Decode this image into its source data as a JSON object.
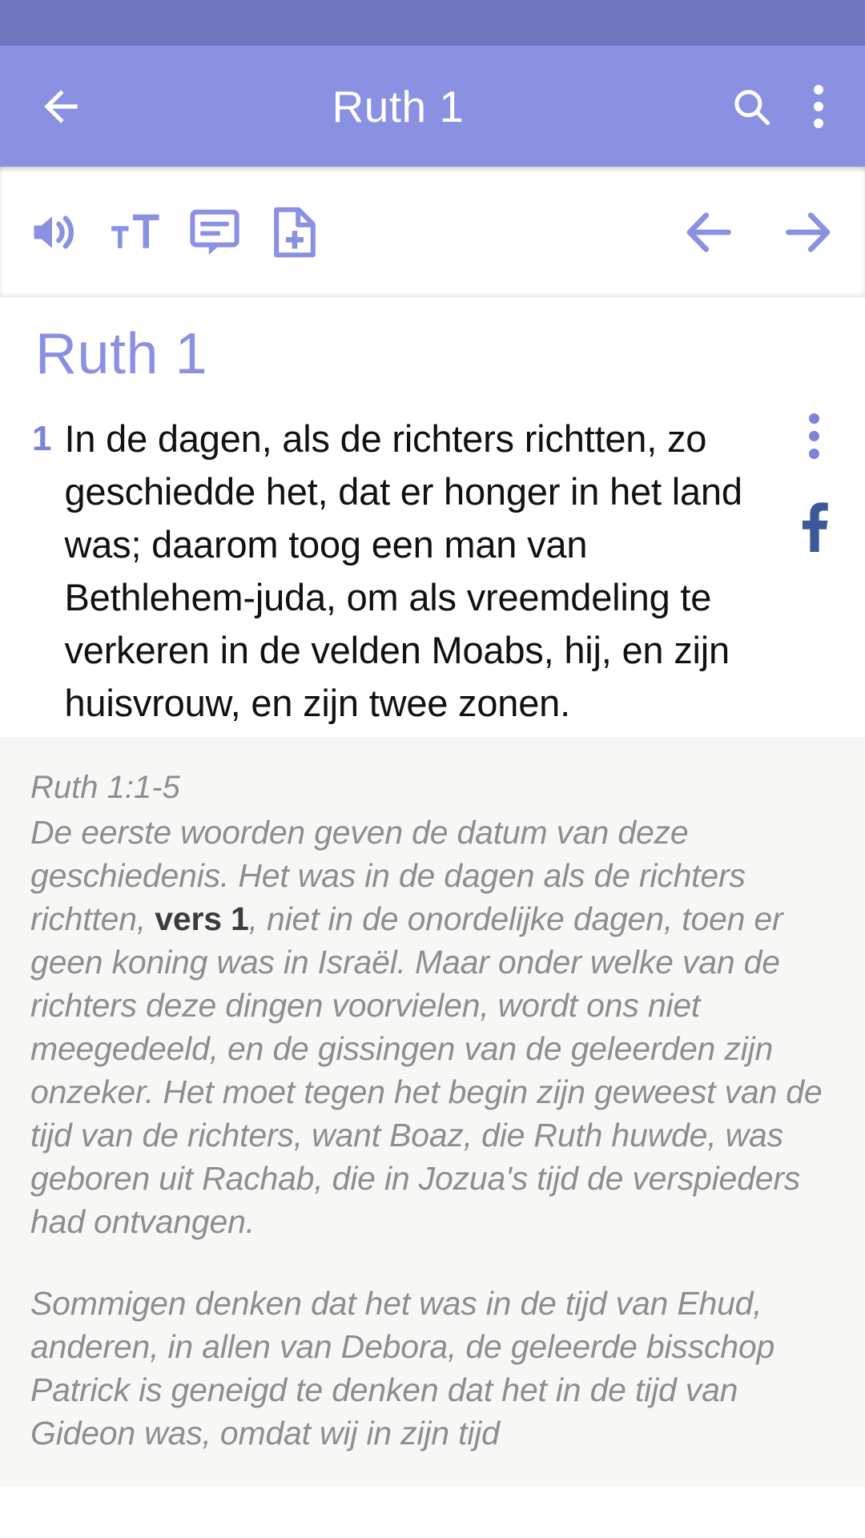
{
  "status_bar": {
    "color": "#6E76BE"
  },
  "app_bar": {
    "color": "#8A90E2",
    "title": "Ruth 1",
    "back_label": "Back",
    "search_label": "Search",
    "overflow_label": "More options"
  },
  "read_toolbar": {
    "audio_label": "Audio",
    "text_size_label": "Text size",
    "notes_label": "Notes",
    "add_note_label": "Add note",
    "prev_label": "Previous chapter",
    "next_label": "Next chapter"
  },
  "chapter": {
    "title": "Ruth 1",
    "accent_color": "#8A90E2"
  },
  "verses": [
    {
      "number": "1",
      "text": "In de dagen, als de richters richtten, zo geschiedde het, dat er honger in het land was; daarom toog een man van Bethlehem-juda, om als vreemdeling te verkeren in de velden Moabs, hij, en zijn huisvrouw, en zijn twee zonen."
    }
  ],
  "verse_actions": {
    "more_label": "Verse options",
    "facebook_label": "Share on Facebook",
    "facebook_color": "#3B5998"
  },
  "commentary": {
    "reference": "Ruth 1:1-5",
    "paragraph1_part1": "De eerste woorden geven de datum van deze geschiedenis. Het was in de dagen als de richters richtten, ",
    "paragraph1_highlight": "vers 1",
    "paragraph1_part2": ", niet in de onordelijke dagen, toen er geen koning was in Israël. Maar onder welke van de richters deze dingen voorvielen, wordt ons niet meegedeeld, en de gissingen van de geleerden zijn onzeker. Het moet tegen het begin zijn geweest van de tijd van de richters, want Boaz, die Ruth huwde, was geboren uit Rachab, die in Jozua's tijd de verspieders had ontvangen.",
    "paragraph2": "Sommigen denken dat het was in de tijd van Ehud, anderen, in allen van Debora, de geleerde bisschop Patrick is geneigd te denken dat het in de tijd van Gideon was, omdat wij in zijn tijd"
  }
}
